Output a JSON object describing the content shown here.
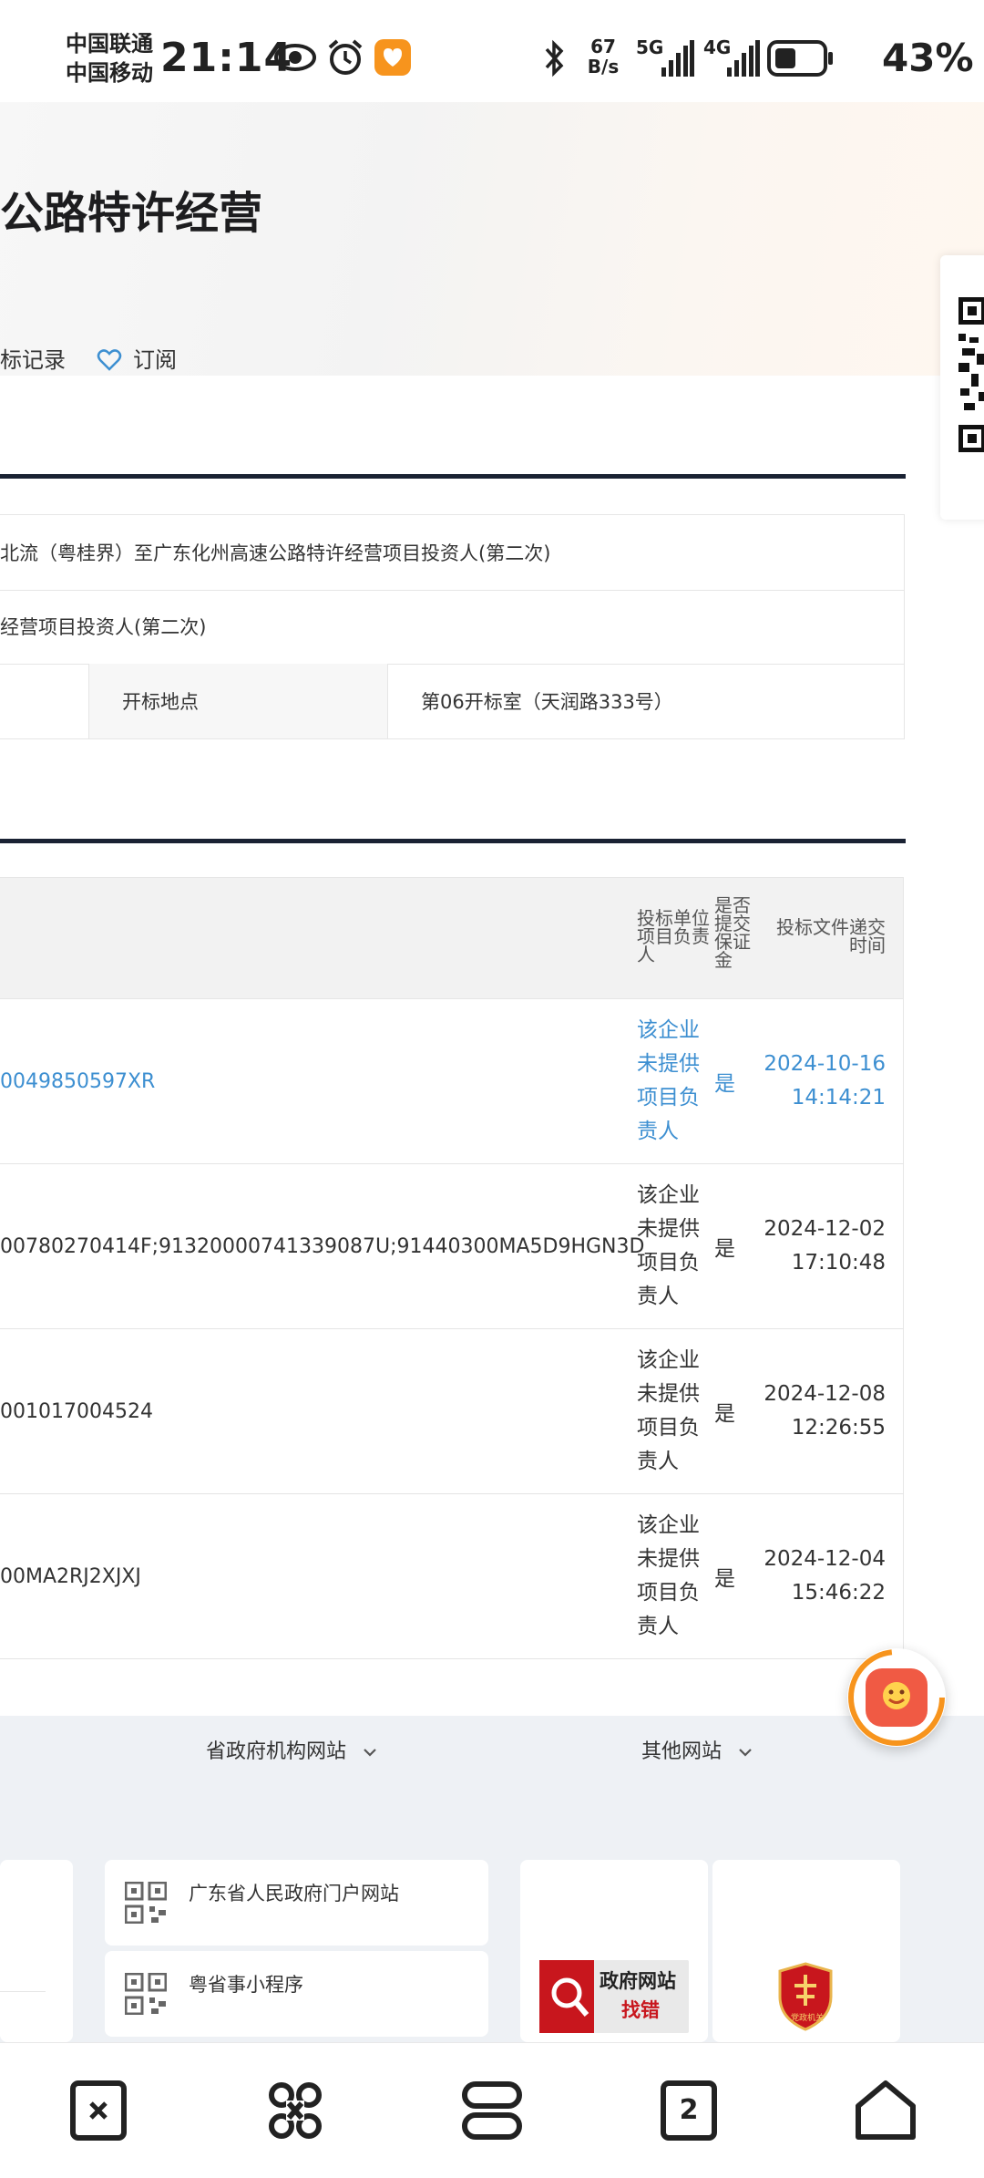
{
  "status_bar": {
    "carrier_1": "中国联通",
    "carrier_2": "中国移动",
    "time": "21:14",
    "net_speed_value": "67",
    "net_speed_unit": "B/s",
    "sig1_label": "5G",
    "sig2_label": "4G",
    "battery": "43%"
  },
  "header": {
    "title": "公路特许经营",
    "action_record": "标记录",
    "action_subscribe": "订阅"
  },
  "info_table": {
    "row1_text": "北流（粤桂界）至广东化州高速公路特许经营项目投资人(第二次)",
    "row2_text": "经营项目投资人(第二次)",
    "row3_label": "开标地点",
    "row3_value": "第06开标室（天润路333号）"
  },
  "bidder_table": {
    "headers": {
      "lead": "投标单位项目负责人",
      "deposit": "是否提交保证金",
      "time": "投标文件递交时间"
    },
    "rows": [
      {
        "code": "0049850597XR",
        "lead": "该企业未提供项目负责人",
        "deposit": "是",
        "time": "2024-10-16 14:14:21",
        "highlight": true
      },
      {
        "code": "00780270414F;91320000741339087U;91440300MA5D9HGN3D",
        "lead": "该企业未提供项目负责人",
        "deposit": "是",
        "time": "2024-12-02 17:10:48",
        "highlight": false
      },
      {
        "code": "001017004524",
        "lead": "该企业未提供项目负责人",
        "deposit": "是",
        "time": "2024-12-08 12:26:55",
        "highlight": false
      },
      {
        "code": "00MA2RJ2XJXJ",
        "lead": "该企业未提供项目负责人",
        "deposit": "是",
        "time": "2024-12-04 15:46:22",
        "highlight": false
      }
    ]
  },
  "footer": {
    "nav_gov": "省政府机构网站",
    "nav_other": "其他网站",
    "link_portal": "广东省人民政府门户网站",
    "link_app": "粤省事小程序",
    "badge_gov_1": "政府网站",
    "badge_gov_2": "找错",
    "badge_shield": "党政机关"
  },
  "bottom_nav": {
    "tab_count": "2"
  },
  "colors": {
    "link_blue": "#3d8fd1",
    "rule_dark": "#1a2233",
    "accent_orange": "#f7941d"
  }
}
